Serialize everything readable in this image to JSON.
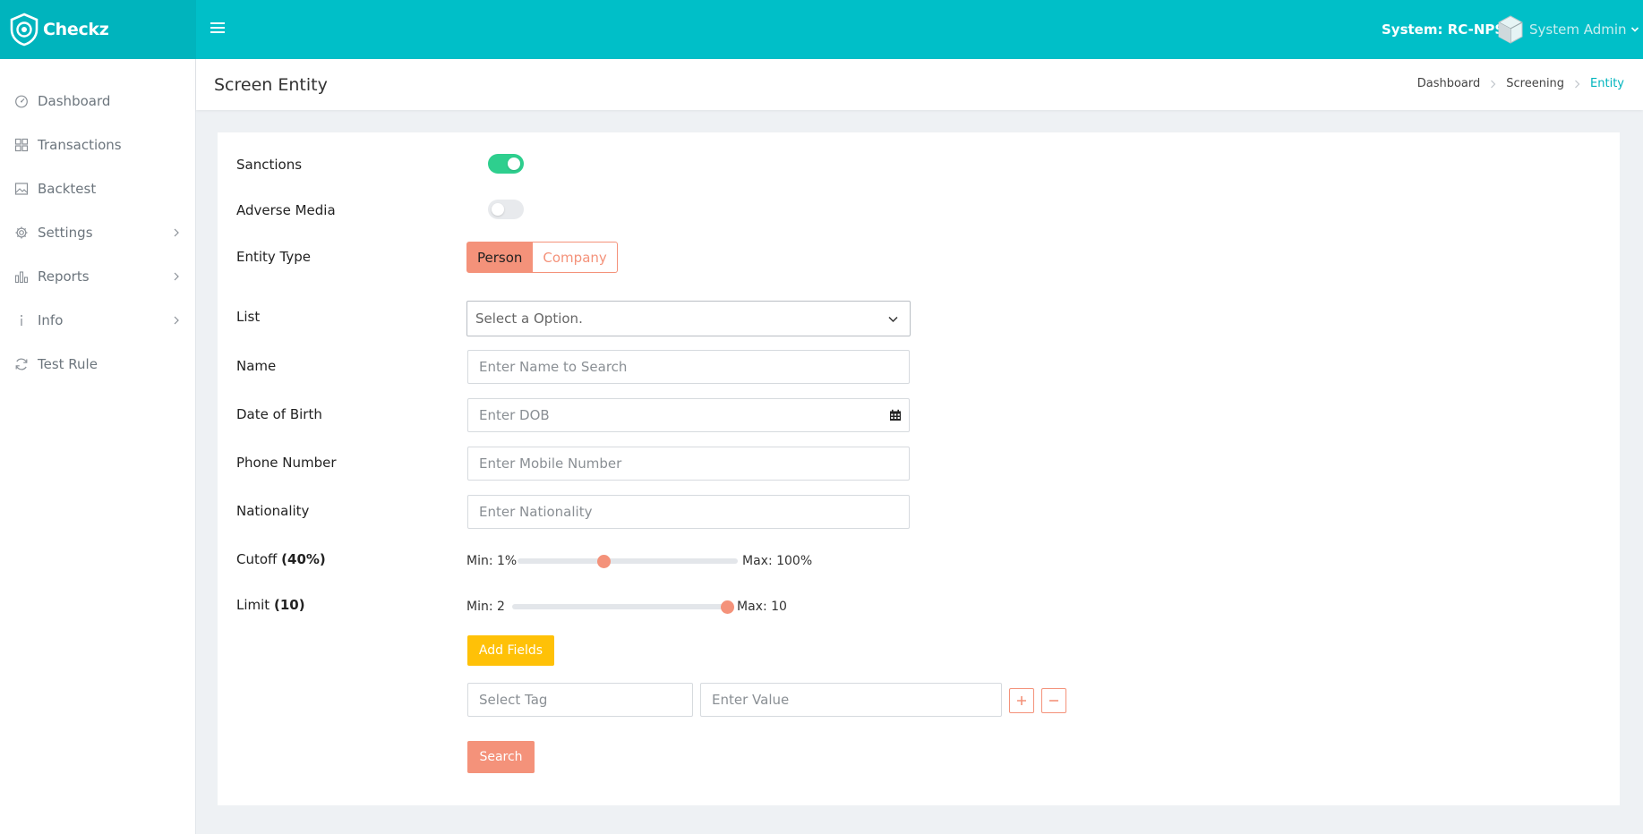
{
  "app": {
    "brand": "Checkz"
  },
  "topbar": {
    "system_label": "System: RC-NPS",
    "user_name": "System Admin"
  },
  "sidebar": {
    "items": [
      {
        "label": "Dashboard",
        "icon": "gauge-icon"
      },
      {
        "label": "Transactions",
        "icon": "grid-icon"
      },
      {
        "label": "Backtest",
        "icon": "image-icon"
      },
      {
        "label": "Settings",
        "icon": "gear-icon",
        "has_submenu": true
      },
      {
        "label": "Reports",
        "icon": "bar-chart-icon",
        "has_submenu": true
      },
      {
        "label": "Info",
        "icon": "info-icon",
        "has_submenu": true
      },
      {
        "label": "Test Rule",
        "icon": "refresh-icon"
      }
    ]
  },
  "page": {
    "title": "Screen Entity",
    "breadcrumb": [
      "Dashboard",
      "Screening",
      "Entity"
    ]
  },
  "form": {
    "sanctions": {
      "label": "Sanctions",
      "enabled": true
    },
    "adverse_media": {
      "label": "Adverse Media",
      "enabled": false
    },
    "entity_type": {
      "label": "Entity Type",
      "options": [
        "Person",
        "Company"
      ],
      "selected": "Person"
    },
    "list": {
      "label": "List",
      "value": "Select a Option."
    },
    "name": {
      "label": "Name",
      "placeholder": "Enter Name to Search"
    },
    "dob": {
      "label": "Date of Birth",
      "placeholder": "Enter DOB"
    },
    "phone": {
      "label": "Phone Number",
      "placeholder": "Enter Mobile Number"
    },
    "nationality": {
      "label": "Nationality",
      "placeholder": "Enter Nationality"
    },
    "cutoff": {
      "label": "Cutoff",
      "value_text": "(40%)",
      "min_text": "Min: 1%",
      "max_text": "Max: 100%",
      "min": 1,
      "max": 100,
      "value": 40
    },
    "limit": {
      "label": "Limit",
      "value_text": "(10)",
      "min_text": "Min: 2",
      "max_text": "Max: 10",
      "min": 2,
      "max": 10,
      "value": 10
    },
    "add_fields_label": "Add Fields",
    "tag": {
      "placeholder": "Select Tag"
    },
    "tag_value": {
      "placeholder": "Enter Value"
    },
    "search_label": "Search"
  },
  "colors": {
    "primary": "#00bfc8",
    "accent": "#f4927a",
    "toggle_on": "#2ecf8e",
    "warning": "#ffc107"
  }
}
